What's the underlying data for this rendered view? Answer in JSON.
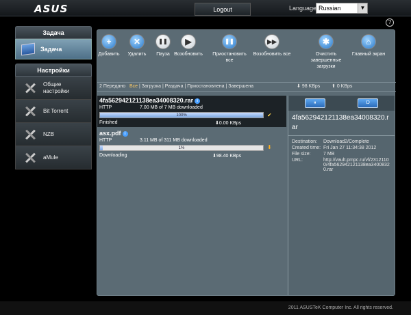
{
  "header": {
    "logo": "ASUS",
    "logout": "Logout",
    "language_label": "Language",
    "language_value": "Russian"
  },
  "sidebar": {
    "task_section": "Задача",
    "task_item": "Задача",
    "settings_section": "Настройки",
    "items": [
      {
        "label": "Общие настройки"
      },
      {
        "label": "Bit Torrent"
      },
      {
        "label": "NZB"
      },
      {
        "label": "aMule"
      }
    ]
  },
  "toolbar": {
    "buttons": [
      {
        "label": "Добавить",
        "glyph": "+"
      },
      {
        "label": "Удалить",
        "glyph": "✕"
      },
      {
        "label": "Пауза",
        "glyph": "❚❚"
      },
      {
        "label": "Возобновить",
        "glyph": "▶"
      },
      {
        "label": "Приостановить все",
        "glyph": "❚❚"
      },
      {
        "label": "Возобновить все",
        "glyph": "▶▶"
      },
      {
        "label": "Очистить завершенные загрузки",
        "glyph": "✱"
      },
      {
        "label": "Главный экран",
        "glyph": "⌂"
      }
    ]
  },
  "filters": {
    "count": "2 Передано",
    "all": "Все",
    "download": "Загрузка",
    "seed": "Раздача",
    "paused": "Приостановлена",
    "finished": "Завершена",
    "down_speed": "98 KBps",
    "up_speed": "0 KBps"
  },
  "transfers": [
    {
      "name": "4fa562942121138ea34008320.rar",
      "type": "HTTP",
      "size": "7.00 MB of 7 MB downloaded",
      "progress_label": "100%",
      "progress": 1.0,
      "status": "Finished",
      "speed": "0.00 KBps",
      "status_icon": "✔"
    },
    {
      "name": "asx.pdf",
      "type": "HTTP",
      "size": "3.11 MB of 311 MB downloaded",
      "progress_label": "1%",
      "progress": 0.01,
      "status": "Downloading",
      "speed": "98.40 KBps",
      "status_icon": "⬇"
    }
  ],
  "details": {
    "title": "4fa562942121138ea34008320.rar",
    "rows": [
      {
        "k": "Destination:",
        "v": "Download2/Complete"
      },
      {
        "k": "Created time:",
        "v": "Fri Jan 27 11:34:38 2012"
      },
      {
        "k": "File size:",
        "v": "7 MB"
      },
      {
        "k": "URL:",
        "v": "http://vault.pmpc.ru/vf/23121100/4fa562942121138ea34008320.rar"
      }
    ]
  },
  "footer": "2011 ASUSTeK Computer Inc. All rights reserved."
}
